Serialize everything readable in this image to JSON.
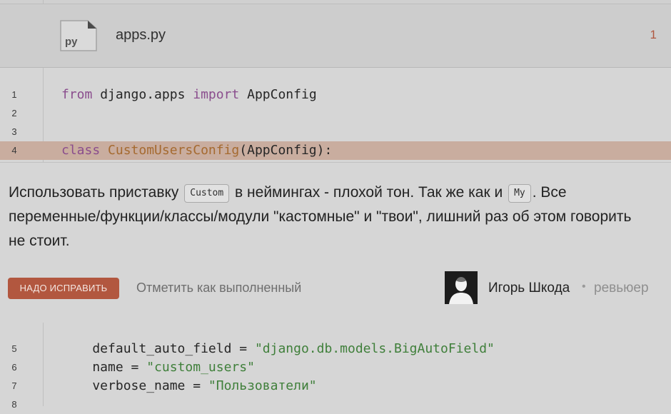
{
  "file": {
    "icon_label": "py",
    "name": "apps.py",
    "comment_count": "1"
  },
  "code_top": [
    {
      "num": "1",
      "parts": [
        {
          "t": "from",
          "c": "kw"
        },
        {
          "t": " django.apps ",
          "c": ""
        },
        {
          "t": "import",
          "c": "kw"
        },
        {
          "t": " AppConfig",
          "c": ""
        }
      ]
    },
    {
      "num": "2",
      "parts": []
    },
    {
      "num": "3",
      "parts": []
    },
    {
      "num": "4",
      "highlight": true,
      "parts": [
        {
          "t": "class",
          "c": "kw"
        },
        {
          "t": " ",
          "c": ""
        },
        {
          "t": "CustomUsersConfig",
          "c": "cls"
        },
        {
          "t": "(AppConfig):",
          "c": ""
        }
      ]
    }
  ],
  "comment": {
    "text_1": "Использовать приставку ",
    "code_1": "Custom",
    "text_2": " в неймингах - плохой тон. Так же как и ",
    "code_2": "My",
    "text_3": ". Все переменные/функции/классы/модули \"кастомные\" и \"твои\", лишний раз об этом говорить не стоит.",
    "fix_button": "НАДО ИСПРАВИТЬ",
    "mark_done": "Отметить как выполненный",
    "reviewer_name": "Игорь Шкода",
    "separator": "•",
    "reviewer_role": "ревьюер"
  },
  "code_bottom": [
    {
      "num": "5",
      "parts": [
        {
          "t": "    default_auto_field = ",
          "c": ""
        },
        {
          "t": "\"django.db.models.BigAutoField\"",
          "c": "str"
        }
      ]
    },
    {
      "num": "6",
      "parts": [
        {
          "t": "    name = ",
          "c": ""
        },
        {
          "t": "\"custom_users\"",
          "c": "str"
        }
      ]
    },
    {
      "num": "7",
      "parts": [
        {
          "t": "    verbose_name = ",
          "c": ""
        },
        {
          "t": "\"Пользователи\"",
          "c": "str"
        }
      ]
    },
    {
      "num": "8",
      "parts": []
    }
  ],
  "colors": {
    "accent_button": "#b2573f",
    "highlight_line": "#c9ad9f",
    "keyword": "#8a4d8d",
    "class_name": "#a56a30",
    "string": "#3f7f3a"
  }
}
